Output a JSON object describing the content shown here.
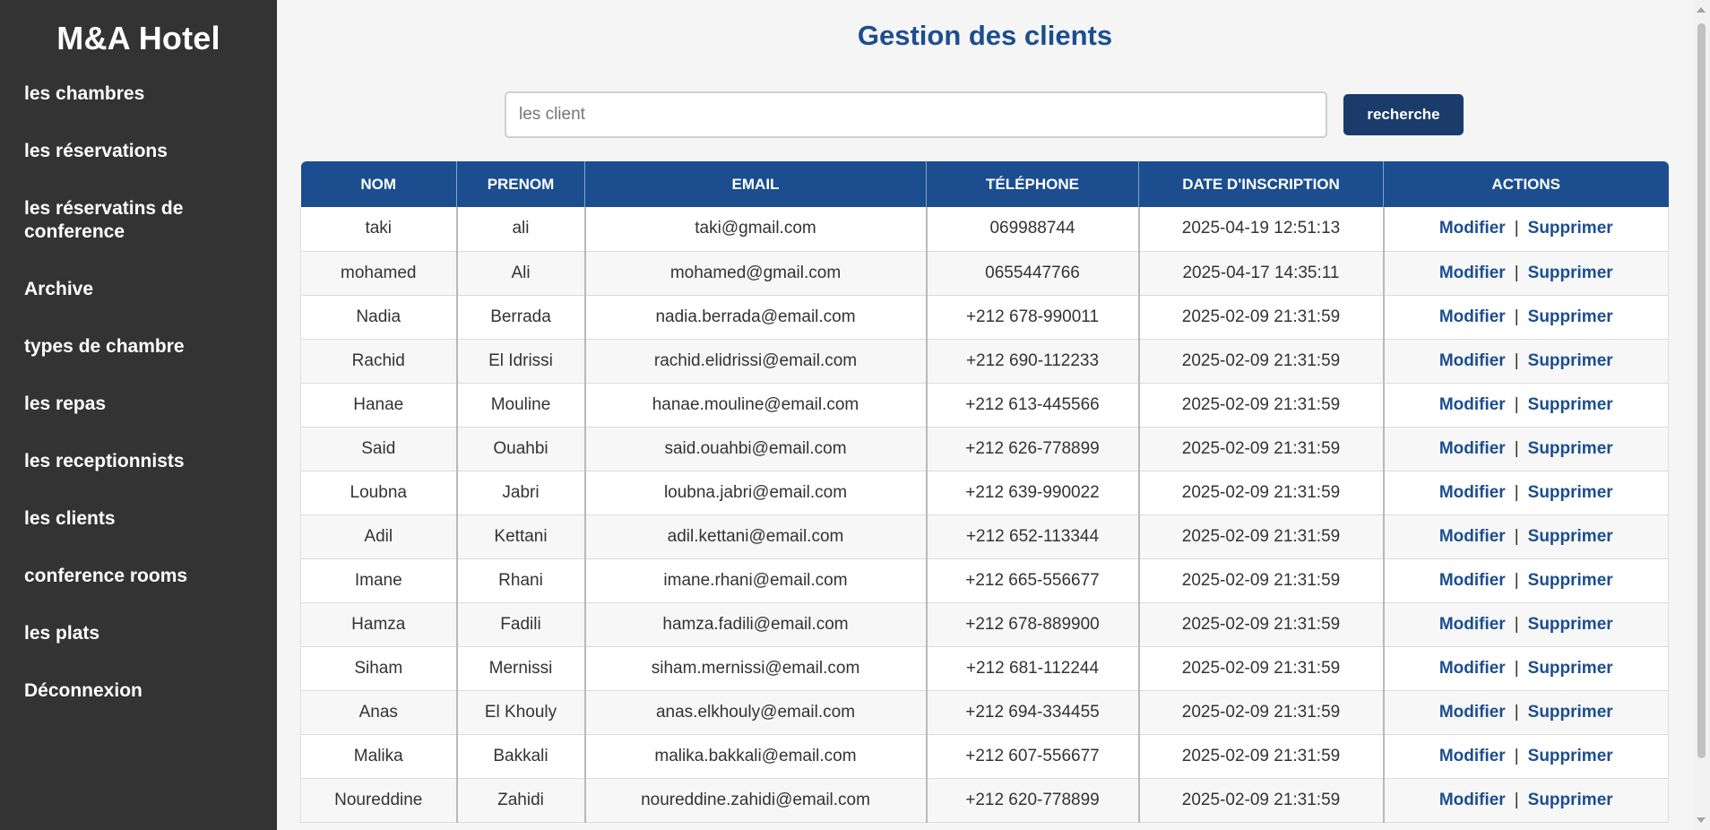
{
  "sidebar": {
    "brand": "M&A Hotel",
    "items": [
      "les chambres",
      "les réservations",
      "les réservatins de conference",
      "Archive",
      "types de chambre",
      "les repas",
      "les receptionnists",
      "les clients",
      "conference rooms",
      "les plats",
      "Déconnexion"
    ]
  },
  "main": {
    "title": "Gestion des clients",
    "search": {
      "placeholder": "les client",
      "value": "",
      "button_label": "recherche"
    },
    "table": {
      "columns": [
        "NOM",
        "PRENOM",
        "EMAIL",
        "TÉLÉPHONE",
        "DATE D'INSCRIPTION",
        "ACTIONS"
      ],
      "action_edit": "Modifier",
      "action_separator": "|",
      "action_delete": "Supprimer",
      "rows": [
        [
          "taki",
          "ali",
          "taki@gmail.com",
          "069988744",
          "2025-04-19 12:51:13"
        ],
        [
          "mohamed",
          "Ali",
          "mohamed@gmail.com",
          "0655447766",
          "2025-04-17 14:35:11"
        ],
        [
          "Nadia",
          "Berrada",
          "nadia.berrada@email.com",
          "+212 678-990011",
          "2025-02-09 21:31:59"
        ],
        [
          "Rachid",
          "El Idrissi",
          "rachid.elidrissi@email.com",
          "+212 690-112233",
          "2025-02-09 21:31:59"
        ],
        [
          "Hanae",
          "Mouline",
          "hanae.mouline@email.com",
          "+212 613-445566",
          "2025-02-09 21:31:59"
        ],
        [
          "Said",
          "Ouahbi",
          "said.ouahbi@email.com",
          "+212 626-778899",
          "2025-02-09 21:31:59"
        ],
        [
          "Loubna",
          "Jabri",
          "loubna.jabri@email.com",
          "+212 639-990022",
          "2025-02-09 21:31:59"
        ],
        [
          "Adil",
          "Kettani",
          "adil.kettani@email.com",
          "+212 652-113344",
          "2025-02-09 21:31:59"
        ],
        [
          "Imane",
          "Rhani",
          "imane.rhani@email.com",
          "+212 665-556677",
          "2025-02-09 21:31:59"
        ],
        [
          "Hamza",
          "Fadili",
          "hamza.fadili@email.com",
          "+212 678-889900",
          "2025-02-09 21:31:59"
        ],
        [
          "Siham",
          "Mernissi",
          "siham.mernissi@email.com",
          "+212 681-112244",
          "2025-02-09 21:31:59"
        ],
        [
          "Anas",
          "El Khouly",
          "anas.elkhouly@email.com",
          "+212 694-334455",
          "2025-02-09 21:31:59"
        ],
        [
          "Malika",
          "Bakkali",
          "malika.bakkali@email.com",
          "+212 607-556677",
          "2025-02-09 21:31:59"
        ],
        [
          "Noureddine",
          "Zahidi",
          "noureddine.zahidi@email.com",
          "+212 620-778899",
          "2025-02-09 21:31:59"
        ]
      ]
    }
  },
  "colors": {
    "sidebar_bg": "#333333",
    "accent": "#1c4e8f",
    "button_bg": "#1b3c6a"
  }
}
